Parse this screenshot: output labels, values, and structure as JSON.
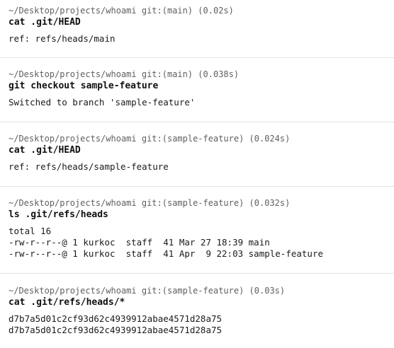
{
  "blocks": [
    {
      "prompt": "~/Desktop/projects/whoami git:(main) (0.02s)",
      "command": "cat .git/HEAD",
      "output": [
        "ref: refs/heads/main"
      ]
    },
    {
      "prompt": "~/Desktop/projects/whoami git:(main) (0.038s)",
      "command": "git checkout sample-feature",
      "output": [
        "Switched to branch 'sample-feature'"
      ]
    },
    {
      "prompt": "~/Desktop/projects/whoami git:(sample-feature) (0.024s)",
      "command": "cat .git/HEAD",
      "output": [
        "ref: refs/heads/sample-feature"
      ]
    },
    {
      "prompt": "~/Desktop/projects/whoami git:(sample-feature) (0.032s)",
      "command": "ls .git/refs/heads",
      "output": [
        "total 16",
        "-rw-r--r--@ 1 kurkoc  staff  41 Mar 27 18:39 main",
        "-rw-r--r--@ 1 kurkoc  staff  41 Apr  9 22:03 sample-feature"
      ]
    },
    {
      "prompt": "~/Desktop/projects/whoami git:(sample-feature) (0.03s)",
      "command": "cat .git/refs/heads/*",
      "output": [
        "d7b7a5d01c2cf93d62c4939912abae4571d28a75",
        "d7b7a5d01c2cf93d62c4939912abae4571d28a75"
      ]
    }
  ]
}
